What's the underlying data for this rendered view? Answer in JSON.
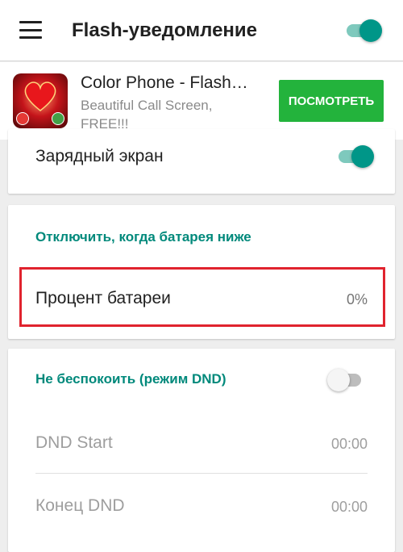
{
  "app_bar": {
    "title": "Flash-уведомление",
    "menu_icon": "hamburger-menu-icon",
    "main_switch_on": true
  },
  "ad": {
    "icon": "heart-call-app-icon",
    "title": "Color Phone - Flash…",
    "subtitle": "Beautiful Call Screen, FREE!!!",
    "button_label": "ПОСМОТРЕТЬ",
    "button_color": "#23b33c"
  },
  "charging_card": {
    "label": "Зарядный экран",
    "switch_on": true
  },
  "battery_card": {
    "header": "Отключить, когда батарея ниже",
    "row_label": "Процент батареи",
    "row_value": "0%"
  },
  "dnd_card": {
    "header": "Не беспокоить (режим DND)",
    "switch_on": false,
    "start_label": "DND Start",
    "start_value": "00:00",
    "end_label": "Конец DND",
    "end_value": "00:00"
  },
  "colors": {
    "accent": "#009688",
    "accent_text": "#00897b",
    "highlight_border": "#e0232e"
  }
}
